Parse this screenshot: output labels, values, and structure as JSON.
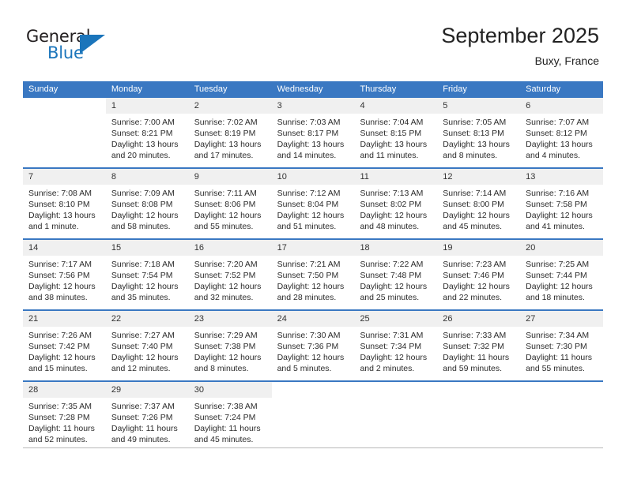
{
  "brand": {
    "name_top": "General",
    "name_bottom": "Blue"
  },
  "header": {
    "title": "September 2025",
    "subtitle": "Buxy, France"
  },
  "colors": {
    "header_blue": "#3a78c2",
    "brand_blue": "#1b75bb",
    "date_band": "#f0f0f0",
    "text": "#2b2b2b"
  },
  "weekdays": [
    "Sunday",
    "Monday",
    "Tuesday",
    "Wednesday",
    "Thursday",
    "Friday",
    "Saturday"
  ],
  "weeks": [
    [
      {
        "day": "",
        "lines": []
      },
      {
        "day": "1",
        "lines": [
          "Sunrise: 7:00 AM",
          "Sunset: 8:21 PM",
          "Daylight: 13 hours",
          "and 20 minutes."
        ]
      },
      {
        "day": "2",
        "lines": [
          "Sunrise: 7:02 AM",
          "Sunset: 8:19 PM",
          "Daylight: 13 hours",
          "and 17 minutes."
        ]
      },
      {
        "day": "3",
        "lines": [
          "Sunrise: 7:03 AM",
          "Sunset: 8:17 PM",
          "Daylight: 13 hours",
          "and 14 minutes."
        ]
      },
      {
        "day": "4",
        "lines": [
          "Sunrise: 7:04 AM",
          "Sunset: 8:15 PM",
          "Daylight: 13 hours",
          "and 11 minutes."
        ]
      },
      {
        "day": "5",
        "lines": [
          "Sunrise: 7:05 AM",
          "Sunset: 8:13 PM",
          "Daylight: 13 hours",
          "and 8 minutes."
        ]
      },
      {
        "day": "6",
        "lines": [
          "Sunrise: 7:07 AM",
          "Sunset: 8:12 PM",
          "Daylight: 13 hours",
          "and 4 minutes."
        ]
      }
    ],
    [
      {
        "day": "7",
        "lines": [
          "Sunrise: 7:08 AM",
          "Sunset: 8:10 PM",
          "Daylight: 13 hours",
          "and 1 minute."
        ]
      },
      {
        "day": "8",
        "lines": [
          "Sunrise: 7:09 AM",
          "Sunset: 8:08 PM",
          "Daylight: 12 hours",
          "and 58 minutes."
        ]
      },
      {
        "day": "9",
        "lines": [
          "Sunrise: 7:11 AM",
          "Sunset: 8:06 PM",
          "Daylight: 12 hours",
          "and 55 minutes."
        ]
      },
      {
        "day": "10",
        "lines": [
          "Sunrise: 7:12 AM",
          "Sunset: 8:04 PM",
          "Daylight: 12 hours",
          "and 51 minutes."
        ]
      },
      {
        "day": "11",
        "lines": [
          "Sunrise: 7:13 AM",
          "Sunset: 8:02 PM",
          "Daylight: 12 hours",
          "and 48 minutes."
        ]
      },
      {
        "day": "12",
        "lines": [
          "Sunrise: 7:14 AM",
          "Sunset: 8:00 PM",
          "Daylight: 12 hours",
          "and 45 minutes."
        ]
      },
      {
        "day": "13",
        "lines": [
          "Sunrise: 7:16 AM",
          "Sunset: 7:58 PM",
          "Daylight: 12 hours",
          "and 41 minutes."
        ]
      }
    ],
    [
      {
        "day": "14",
        "lines": [
          "Sunrise: 7:17 AM",
          "Sunset: 7:56 PM",
          "Daylight: 12 hours",
          "and 38 minutes."
        ]
      },
      {
        "day": "15",
        "lines": [
          "Sunrise: 7:18 AM",
          "Sunset: 7:54 PM",
          "Daylight: 12 hours",
          "and 35 minutes."
        ]
      },
      {
        "day": "16",
        "lines": [
          "Sunrise: 7:20 AM",
          "Sunset: 7:52 PM",
          "Daylight: 12 hours",
          "and 32 minutes."
        ]
      },
      {
        "day": "17",
        "lines": [
          "Sunrise: 7:21 AM",
          "Sunset: 7:50 PM",
          "Daylight: 12 hours",
          "and 28 minutes."
        ]
      },
      {
        "day": "18",
        "lines": [
          "Sunrise: 7:22 AM",
          "Sunset: 7:48 PM",
          "Daylight: 12 hours",
          "and 25 minutes."
        ]
      },
      {
        "day": "19",
        "lines": [
          "Sunrise: 7:23 AM",
          "Sunset: 7:46 PM",
          "Daylight: 12 hours",
          "and 22 minutes."
        ]
      },
      {
        "day": "20",
        "lines": [
          "Sunrise: 7:25 AM",
          "Sunset: 7:44 PM",
          "Daylight: 12 hours",
          "and 18 minutes."
        ]
      }
    ],
    [
      {
        "day": "21",
        "lines": [
          "Sunrise: 7:26 AM",
          "Sunset: 7:42 PM",
          "Daylight: 12 hours",
          "and 15 minutes."
        ]
      },
      {
        "day": "22",
        "lines": [
          "Sunrise: 7:27 AM",
          "Sunset: 7:40 PM",
          "Daylight: 12 hours",
          "and 12 minutes."
        ]
      },
      {
        "day": "23",
        "lines": [
          "Sunrise: 7:29 AM",
          "Sunset: 7:38 PM",
          "Daylight: 12 hours",
          "and 8 minutes."
        ]
      },
      {
        "day": "24",
        "lines": [
          "Sunrise: 7:30 AM",
          "Sunset: 7:36 PM",
          "Daylight: 12 hours",
          "and 5 minutes."
        ]
      },
      {
        "day": "25",
        "lines": [
          "Sunrise: 7:31 AM",
          "Sunset: 7:34 PM",
          "Daylight: 12 hours",
          "and 2 minutes."
        ]
      },
      {
        "day": "26",
        "lines": [
          "Sunrise: 7:33 AM",
          "Sunset: 7:32 PM",
          "Daylight: 11 hours",
          "and 59 minutes."
        ]
      },
      {
        "day": "27",
        "lines": [
          "Sunrise: 7:34 AM",
          "Sunset: 7:30 PM",
          "Daylight: 11 hours",
          "and 55 minutes."
        ]
      }
    ],
    [
      {
        "day": "28",
        "lines": [
          "Sunrise: 7:35 AM",
          "Sunset: 7:28 PM",
          "Daylight: 11 hours",
          "and 52 minutes."
        ]
      },
      {
        "day": "29",
        "lines": [
          "Sunrise: 7:37 AM",
          "Sunset: 7:26 PM",
          "Daylight: 11 hours",
          "and 49 minutes."
        ]
      },
      {
        "day": "30",
        "lines": [
          "Sunrise: 7:38 AM",
          "Sunset: 7:24 PM",
          "Daylight: 11 hours",
          "and 45 minutes."
        ]
      },
      {
        "day": "",
        "lines": []
      },
      {
        "day": "",
        "lines": []
      },
      {
        "day": "",
        "lines": []
      },
      {
        "day": "",
        "lines": []
      }
    ]
  ]
}
